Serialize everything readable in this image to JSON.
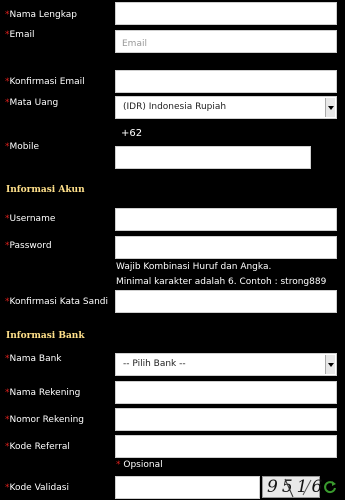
{
  "fields": {
    "nama_lengkap": {
      "label": "Nama Lengkap",
      "value": ""
    },
    "email": {
      "label": "Email",
      "placeholder": "Email",
      "value": ""
    },
    "konfirmasi_email": {
      "label": "Konfirmasi Email",
      "value": ""
    },
    "mata_uang": {
      "label": "Mata Uang",
      "selected": "(IDR) Indonesia Rupiah"
    },
    "mobile": {
      "label": "Mobile",
      "prefix": "+62",
      "value": ""
    }
  },
  "section_akun": {
    "title": "Informasi Akun"
  },
  "akun": {
    "username": {
      "label": "Username",
      "value": ""
    },
    "password": {
      "label": "Password",
      "value": "",
      "hint1": "Wajib Kombinasi Huruf dan Angka.",
      "hint2": "Minimal karakter adalah 6. Contoh : strong889"
    },
    "konfirmasi": {
      "label": "Konfirmasi Kata Sandi",
      "value": ""
    }
  },
  "section_bank": {
    "title": "Informasi Bank"
  },
  "bank": {
    "nama_bank": {
      "label": "Nama Bank",
      "selected": "-- Pilih Bank --"
    },
    "nama_rekening": {
      "label": "Nama Rekening",
      "value": ""
    },
    "nomor_rekening": {
      "label": "Nomor Rekening",
      "value": ""
    },
    "kode_referral": {
      "label": "Kode Referral",
      "value": "",
      "note": "Opsional"
    },
    "kode_validasi": {
      "label": "Kode Validasi",
      "value": "",
      "captcha": "9516"
    }
  },
  "required_mark": "*",
  "colors": {
    "required": "#e0201c",
    "section": "#ffe08a",
    "refresh": "#3a9a2e"
  }
}
